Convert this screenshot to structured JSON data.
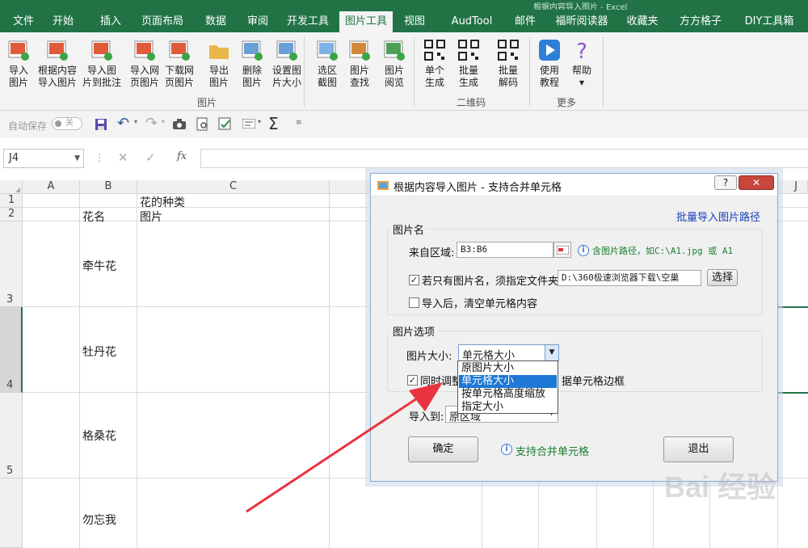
{
  "window": {
    "title_partial": "根据内容导入图片 - Excel"
  },
  "tabs": [
    {
      "label": "文件",
      "active": false
    },
    {
      "label": "开始",
      "active": false
    },
    {
      "label": "插入",
      "active": false
    },
    {
      "label": "页面布局",
      "active": false
    },
    {
      "label": "数据",
      "active": false
    },
    {
      "label": "审阅",
      "active": false
    },
    {
      "label": "开发工具",
      "active": false
    },
    {
      "label": "图片工具",
      "active": true
    },
    {
      "label": "视图",
      "active": false
    },
    {
      "label": "AudTool",
      "active": false
    },
    {
      "label": "邮件",
      "active": false
    },
    {
      "label": "福昕阅读器",
      "active": false
    },
    {
      "label": "收藏夹",
      "active": false
    },
    {
      "label": "方方格子",
      "active": false
    },
    {
      "label": "DIY工具箱",
      "active": false
    }
  ],
  "ribbon": {
    "buttons": [
      {
        "l1": "导入",
        "l2": "图片",
        "icon": "image-add-icon"
      },
      {
        "l1": "根据内容",
        "l2": "导入图片",
        "icon": "image-import-text-icon"
      },
      {
        "l1": "导入图",
        "l2": "片到批注",
        "icon": "image-comment-icon"
      },
      {
        "l1": "导入网",
        "l2": "页图片",
        "icon": "web-image-import-icon"
      },
      {
        "l1": "下载网",
        "l2": "页图片",
        "icon": "web-image-download-icon"
      },
      {
        "l1": "导出",
        "l2": "图片",
        "icon": "folder-export-icon"
      },
      {
        "l1": "删除",
        "l2": "图片",
        "icon": "image-delete-icon"
      },
      {
        "l1": "设置图",
        "l2": "片大小",
        "icon": "image-resize-icon"
      },
      {
        "l1": "选区",
        "l2": "截图",
        "icon": "screenshot-icon"
      },
      {
        "l1": "图片",
        "l2": "查找",
        "icon": "image-find-icon"
      },
      {
        "l1": "图片",
        "l2": "阅览",
        "icon": "image-browse-icon"
      },
      {
        "l1": "单个",
        "l2": "生成",
        "icon": "qrcode-single-icon"
      },
      {
        "l1": "批量",
        "l2": "生成",
        "icon": "qrcode-batch-icon"
      },
      {
        "l1": "批量",
        "l2": "解码",
        "icon": "qrcode-decode-icon"
      },
      {
        "l1": "使用",
        "l2": "教程",
        "icon": "play-tutorial-icon"
      },
      {
        "l1": "帮助",
        "l2": "▾",
        "icon": "help-icon"
      }
    ],
    "groups": {
      "images": "图片",
      "qrcode": "二维码",
      "more": "更多"
    }
  },
  "qat": {
    "autosave_label": "自动保存",
    "autosave_state": "关"
  },
  "namebox": {
    "value": "J4"
  },
  "sheet": {
    "columns": [
      "A",
      "B",
      "C",
      "J"
    ],
    "rows": [
      "1",
      "2",
      "3",
      "4",
      "5"
    ],
    "c1": "花的种类",
    "b2": "花名",
    "c2": "图片",
    "b3": "牵牛花",
    "b4": "牡丹花",
    "b5": "格桑花",
    "b6": "勿忘我"
  },
  "dialog": {
    "title": "根据内容导入图片 - 支持合并单元格",
    "batch_link": "批量导入图片路径",
    "name_group": "图片名",
    "from_label": "来自区域:",
    "from_value": "B3:B6",
    "path_hint": "含图片路径，如C:\\A1.jpg 或 A1",
    "folder_check_label": "若只有图片名，须指定文件夹：",
    "folder_checked": true,
    "folder_value": "D:\\360极速浏览器下载\\空巢",
    "select_button": "选择",
    "clear_label": "导入后，清空单元格内容",
    "clear_checked": false,
    "options_group": "图片选项",
    "size_label": "图片大小:",
    "size_value": "单元格大小",
    "size_options": [
      "原图片大小",
      "单元格大小",
      "按单元格高度缩放",
      "指定大小"
    ],
    "size_selected_index": 1,
    "adjust_label_a": "同时调整",
    "adjust_label_b": "据单元格边框",
    "adjust_checked": true,
    "import_to_label": "导入到:",
    "import_to_value": "原区域",
    "ok_button": "确定",
    "merge_hint": "支持合并单元格",
    "exit_button": "退出"
  },
  "watermark": "Bai 经验"
}
